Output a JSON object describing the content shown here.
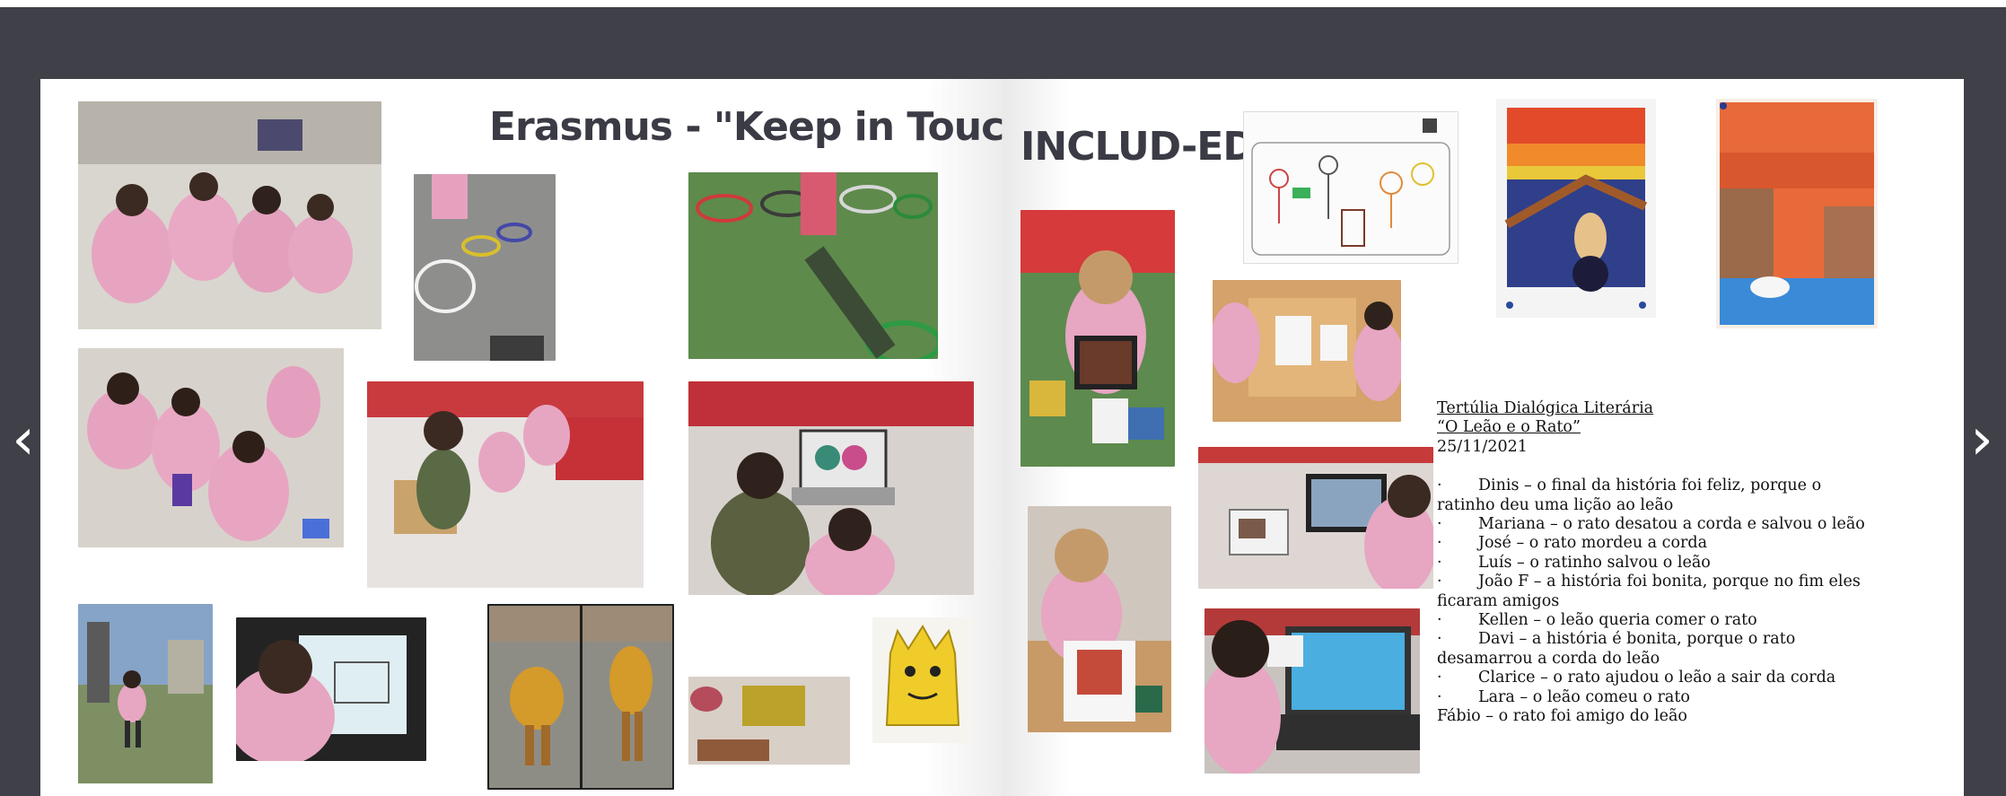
{
  "navigation": {
    "prev_label": "‹",
    "next_label": "›",
    "prev_icon": "chevron-left-icon",
    "next_icon": "chevron-right-icon"
  },
  "left_page": {
    "title": "Erasmus - \"Keep in Touch\""
  },
  "right_page": {
    "title": "INCLUD-ED",
    "text": {
      "heading1": "Tertúlia Dialógica Literária",
      "heading2": "“O Leão e o Rato”",
      "date": "25/11/2021",
      "bullet": "·",
      "items": [
        "Dinis – o final da história foi feliz, porque o ratinho deu uma lição ao leão",
        "Mariana – o rato desatou a corda e salvou o leão",
        "José – o rato mordeu a corda",
        "Luís – o ratinho salvou o leão",
        "João F – a história foi bonita, porque no fim eles ficaram amigos",
        "Kellen – o leão queria comer o rato",
        "Davi – a história é bonita, porque o rato desamarrou a corda do leão",
        "Clarice – o rato ajudou o leão a sair da corda",
        "Lara – o leão comeu o rato"
      ],
      "last_line": "Fábio – o rato foi amigo do leão"
    }
  },
  "colors": {
    "background": "#3f4048",
    "title": "#3a3b44",
    "page": "#ffffff"
  }
}
